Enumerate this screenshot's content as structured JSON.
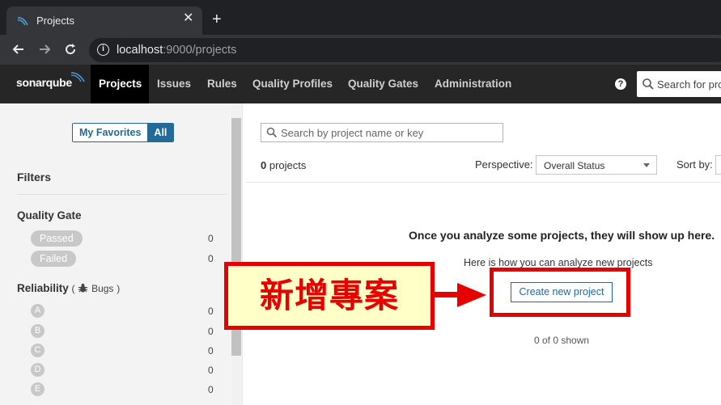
{
  "browser": {
    "tab_title": "Projects",
    "tab_close": "✕",
    "new_tab": "+",
    "url_host": "localhost",
    "url_rest": ":9000/projects"
  },
  "nav": {
    "logo": "sonarqube",
    "items": [
      "Projects",
      "Issues",
      "Rules",
      "Quality Profiles",
      "Quality Gates",
      "Administration"
    ],
    "active_index": 0,
    "help": "?",
    "search_placeholder": "Search for projects"
  },
  "sidebar": {
    "favorites": {
      "my": "My Favorites",
      "all": "All",
      "selected": "all"
    },
    "filters_title": "Filters",
    "quality_gate": {
      "title": "Quality Gate",
      "options": [
        {
          "label": "Passed",
          "count": "0"
        },
        {
          "label": "Failed",
          "count": "0"
        }
      ]
    },
    "reliability": {
      "title": "Reliability",
      "paren_open": "(",
      "paren_close": ")",
      "sub": "Bugs",
      "ratings": [
        {
          "label": "A",
          "count": "0"
        },
        {
          "label": "B",
          "count": "0"
        },
        {
          "label": "C",
          "count": "0"
        },
        {
          "label": "D",
          "count": "0"
        },
        {
          "label": "E",
          "count": "0"
        }
      ]
    }
  },
  "main": {
    "search_placeholder": "Search by project name or key",
    "project_count": "0",
    "project_count_label": "projects",
    "perspective_label": "Perspective:",
    "perspective_value": "Overall Status",
    "sort_label": "Sort by:",
    "empty_title": "Once you analyze some projects, they will show up here.",
    "empty_sub": "Here is how you can analyze new projects",
    "create_button": "Create new project",
    "shown": "0 of 0 shown"
  },
  "annotation": {
    "callout_text": "新增專案"
  },
  "colors": {
    "accent": "#236a97",
    "annotation_red": "#e60000",
    "callout_fill": "#ffffc8",
    "nav_bg": "#262626"
  }
}
